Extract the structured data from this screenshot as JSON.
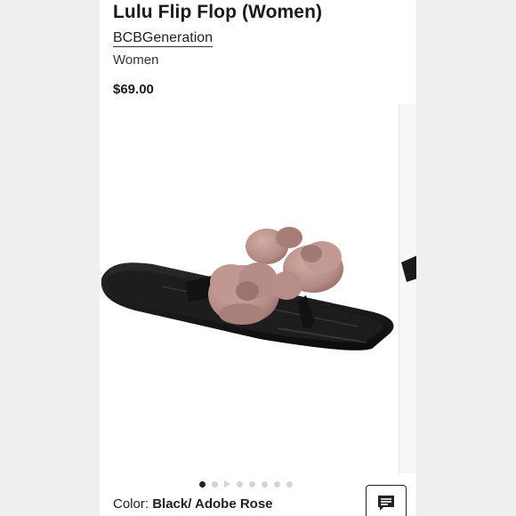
{
  "product": {
    "title": "Lulu Flip Flop (Women)",
    "brand": "BCBGeneration",
    "audience": "Women",
    "price": "$69.00"
  },
  "gallery": {
    "image_subject": "black jelly flip flop sandal with rose flowers",
    "total_slides": 8,
    "active_slide": 1,
    "video_slide_index": 3
  },
  "variant": {
    "color_label": "Color:",
    "color_value": "Black/ Adobe Rose"
  },
  "icons": {
    "chat": "chat-icon"
  },
  "colors": {
    "sandal_black": "#141414",
    "flower_rose": "#b89089",
    "active_dot": "#222222",
    "inactive_dot": "#d4d4d4"
  }
}
